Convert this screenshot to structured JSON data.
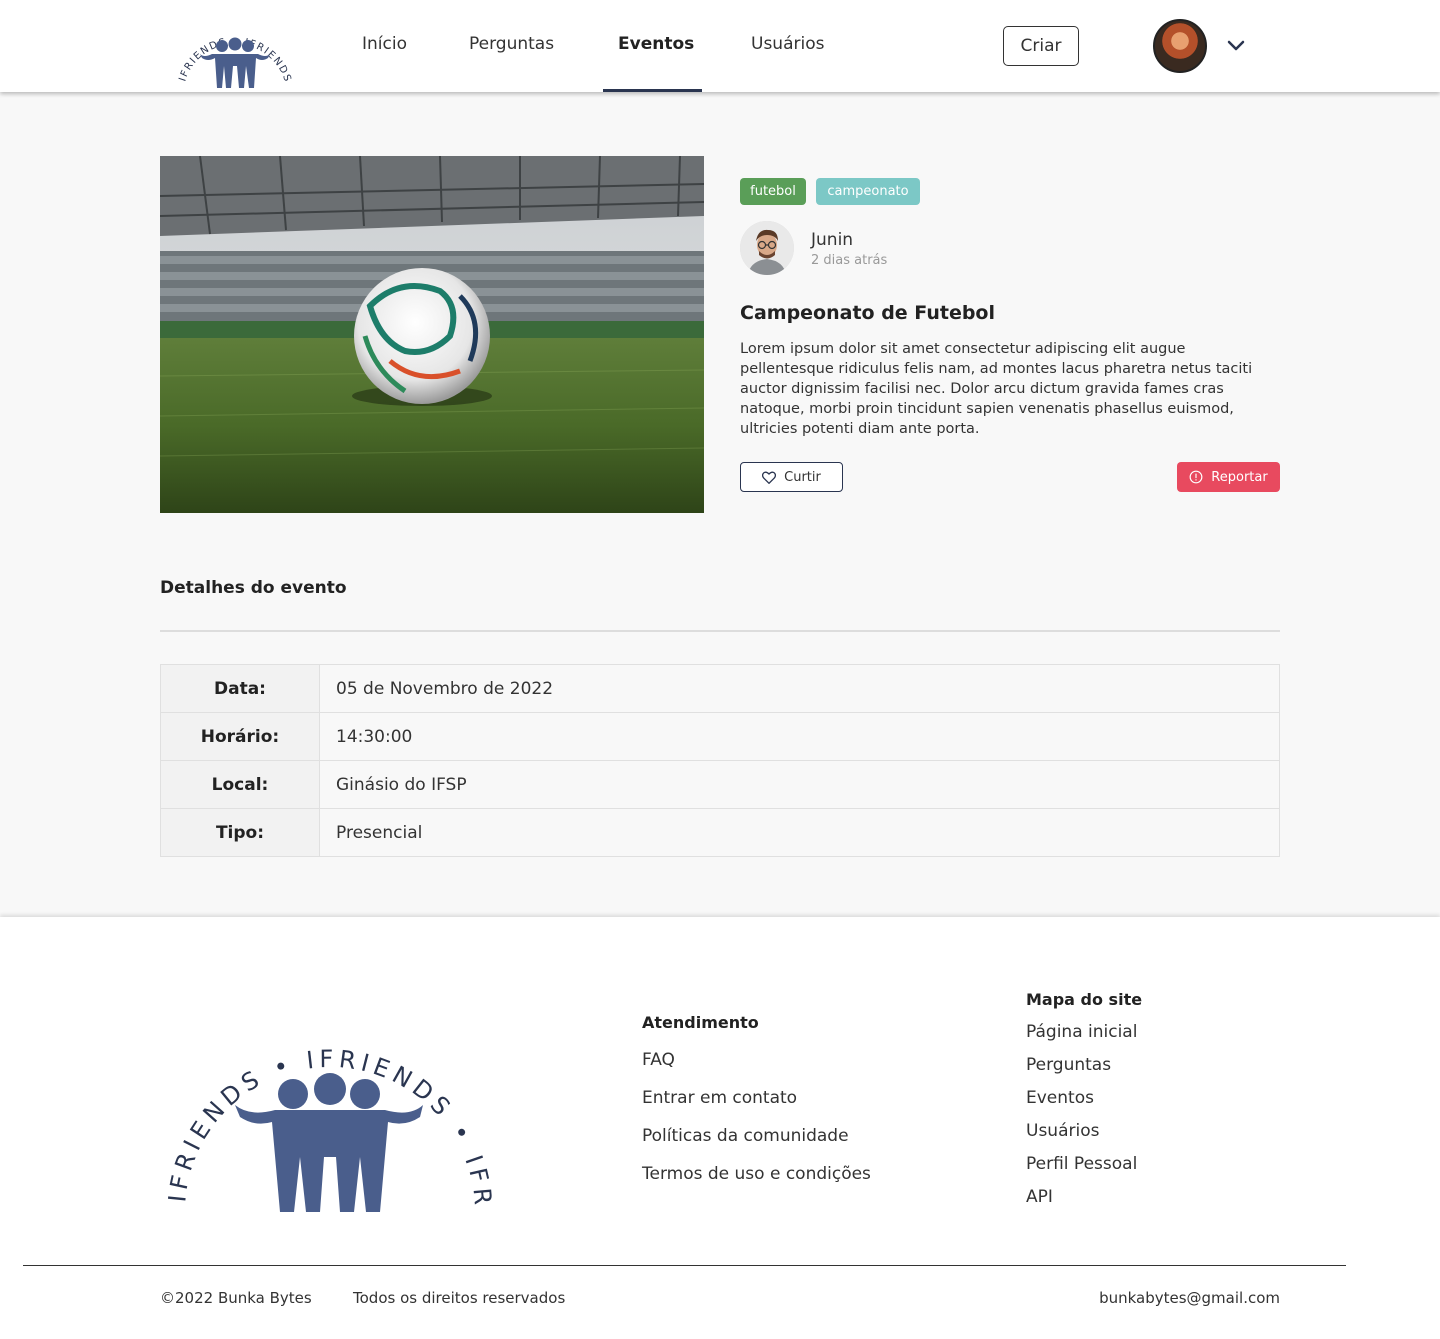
{
  "header": {
    "logo_text": "IFRIENDS",
    "nav": [
      {
        "label": "Início"
      },
      {
        "label": "Perguntas"
      },
      {
        "label": "Eventos"
      },
      {
        "label": "Usuários"
      }
    ],
    "create_label": "Criar"
  },
  "event": {
    "tags": [
      "futebol",
      "campeonato"
    ],
    "author": "Junin",
    "posted": "2 dias atrás",
    "title": "Campeonato de Futebol",
    "description": "Lorem ipsum dolor sit amet consectetur adipiscing elit augue pellentesque ridiculus felis nam, ad montes lacus pharetra netus taciti auctor dignissim facilisi nec. Dolor arcu dictum gravida fames cras natoque, morbi proin tincidunt sapien venenatis phasellus euismod, ultricies potenti diam ante porta.",
    "like_label": "Curtir",
    "report_label": "Reportar"
  },
  "details": {
    "heading": "Detalhes do evento",
    "rows": [
      {
        "label": "Data:",
        "value": "05 de Novembro de 2022"
      },
      {
        "label": "Horário:",
        "value": "14:30:00"
      },
      {
        "label": "Local:",
        "value": "Ginásio do IFSP"
      },
      {
        "label": "Tipo:",
        "value": "Presencial"
      }
    ]
  },
  "footer": {
    "support": {
      "heading": "Atendimento",
      "links": [
        "FAQ",
        "Entrar em contato",
        "Políticas da comunidade",
        "Termos de uso e condições"
      ]
    },
    "sitemap": {
      "heading": "Mapa do site",
      "links": [
        "Página inicial",
        "Perguntas",
        "Eventos",
        "Usuários",
        "Perfil Pessoal",
        "API"
      ]
    },
    "copyright": "©2022 Bunka Bytes",
    "rights": "Todos os direitos reservados",
    "email": "bunkabytes@gmail.com"
  },
  "colors": {
    "brand": "#4a5e8c",
    "nav_active": "#2a3550",
    "tag_green": "#5a9e58",
    "tag_teal": "#7cc8c6",
    "report": "#e84a5f"
  }
}
